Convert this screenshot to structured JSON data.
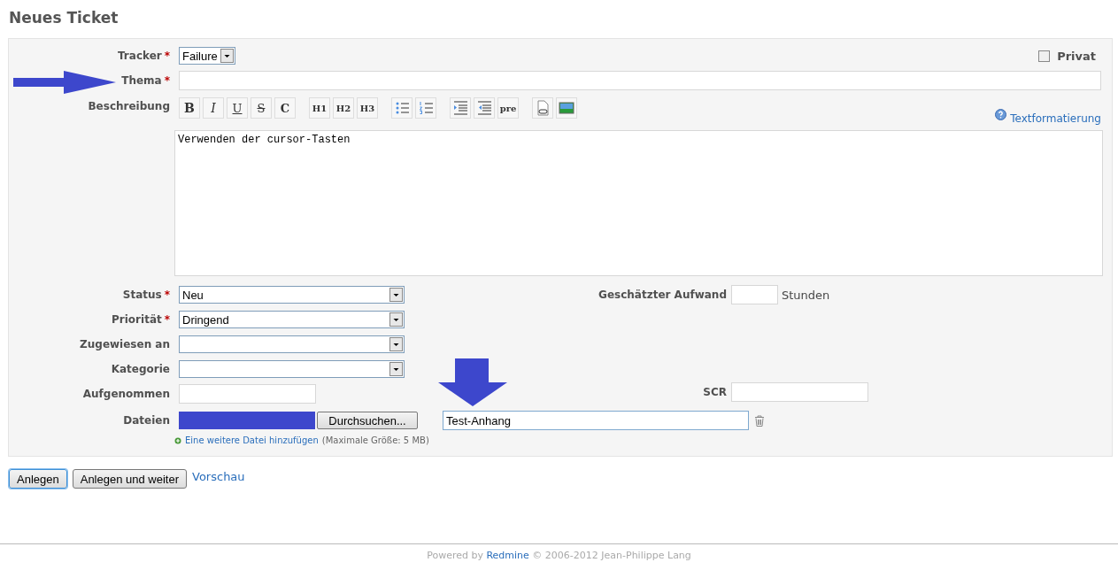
{
  "title": "Neues Ticket",
  "tracker": {
    "label": "Tracker",
    "required_mark": "*",
    "value": "Failure"
  },
  "private": {
    "label": "Privat",
    "checked": false
  },
  "subject": {
    "label": "Thema",
    "required_mark": "*"
  },
  "description": {
    "label": "Beschreibung",
    "help_link": "Textformatierung",
    "text": "Verwenden der cursor-Tasten",
    "toolbar": [
      {
        "kind": "bold",
        "label": "B"
      },
      {
        "kind": "italic",
        "label": "I"
      },
      {
        "kind": "underline",
        "label": "U"
      },
      {
        "kind": "strike",
        "label": "S"
      },
      {
        "kind": "code",
        "label": "C"
      },
      {
        "kind": "sep"
      },
      {
        "kind": "text",
        "label": "H1"
      },
      {
        "kind": "text",
        "label": "H2"
      },
      {
        "kind": "text",
        "label": "H3"
      },
      {
        "kind": "sep"
      },
      {
        "kind": "ul"
      },
      {
        "kind": "ol"
      },
      {
        "kind": "sep"
      },
      {
        "kind": "indent"
      },
      {
        "kind": "outdent"
      },
      {
        "kind": "text",
        "label": "pre"
      },
      {
        "kind": "sep"
      },
      {
        "kind": "link"
      },
      {
        "kind": "image"
      }
    ]
  },
  "left_fields": [
    {
      "kind": "select",
      "label": "Status",
      "required_mark": "*",
      "value": "Neu"
    },
    {
      "kind": "select",
      "label": "Priorität",
      "required_mark": "*",
      "value": "Dringend"
    },
    {
      "kind": "select",
      "label": "Zugewiesen an"
    },
    {
      "kind": "select",
      "label": "Kategorie"
    },
    {
      "kind": "text",
      "label": "Aufgenommen"
    }
  ],
  "estimate": {
    "label": "Geschätzter Aufwand",
    "unit": "Stunden"
  },
  "scr": {
    "label": "SCR"
  },
  "files": {
    "label": "Dateien",
    "browse": "Durchsuchen...",
    "description": "Test-Anhang",
    "add_link": "Eine weitere Datei hinzufügen",
    "note": "(Maximale Größe: 5 MB)"
  },
  "buttons": [
    {
      "label": "Anlegen",
      "focused": true
    },
    {
      "label": "Anlegen und weiter",
      "focused": false
    }
  ],
  "preview_link": "Vorschau",
  "footer": {
    "before": "Powered by ",
    "link": "Redmine",
    "after": " © 2006-2012 Jean-Philippe Lang"
  }
}
